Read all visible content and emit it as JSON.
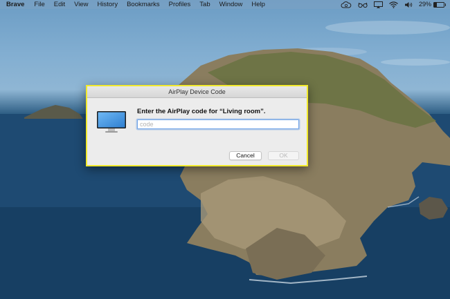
{
  "menubar": {
    "app_name": "Brave",
    "items": [
      "File",
      "Edit",
      "View",
      "History",
      "Bookmarks",
      "Profiles",
      "Tab",
      "Window",
      "Help"
    ],
    "status_icons": [
      "cloud-icon",
      "glasses-icon",
      "airplay-icon",
      "wifi-icon",
      "volume-icon",
      "battery-icon"
    ],
    "battery_percent_text": "29%",
    "battery_level": 0.29
  },
  "dialog": {
    "title": "AirPlay Device Code",
    "prompt": "Enter the AirPlay code for “Living room”.",
    "code_input": {
      "value": "",
      "placeholder": "code"
    },
    "cancel_label": "Cancel",
    "ok_label": "OK",
    "highlight_color": "#f2ea2c"
  },
  "icons": {
    "dialog_icon": "monitor-icon"
  }
}
